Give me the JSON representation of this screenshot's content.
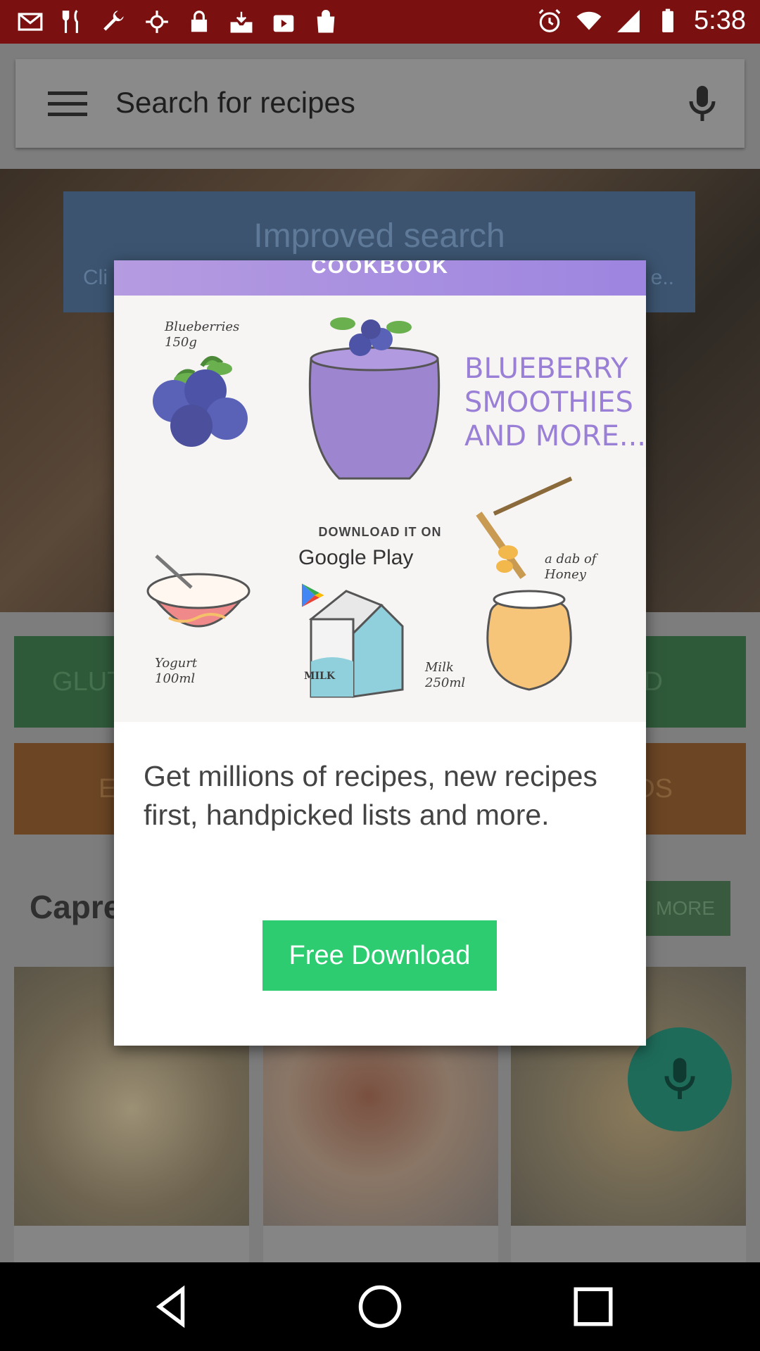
{
  "status_bar": {
    "time": "5:38",
    "icons": [
      "gmail-icon",
      "fork-knife-icon",
      "wrench-icon",
      "fake-gps-icon",
      "lock-icon",
      "inbox-tray-icon",
      "play-store-icon",
      "recipes-bag-icon"
    ]
  },
  "search": {
    "placeholder": "Search for recipes"
  },
  "banner": {
    "title": "Improved search",
    "subtitle_left": "Cli",
    "subtitle_right": "e.."
  },
  "categories": {
    "green_left": "GLUT",
    "green_right": "D",
    "orange_left": "E",
    "orange_right": "DS"
  },
  "section": {
    "title": "Capre",
    "more_label": "MORE"
  },
  "dialog": {
    "promo_band": "COOKBOOK",
    "promo_heading_lines": [
      "BLUEBERRY",
      "SMOOTHIES",
      "AND MORE..."
    ],
    "promo_download": "DOWNLOAD IT ON",
    "promo_store": "Google Play",
    "label_blueberries": "Blueberries\n150g",
    "label_yogurt": "Yogurt\n100ml",
    "label_milk": "Milk\n250ml",
    "label_honey": "a dab of\nHoney",
    "carton_label": "MILK",
    "message": "Get millions of recipes, new recipes first, handpicked lists and more.",
    "button_label": "Free Download",
    "button_color": "#2ecc71"
  }
}
